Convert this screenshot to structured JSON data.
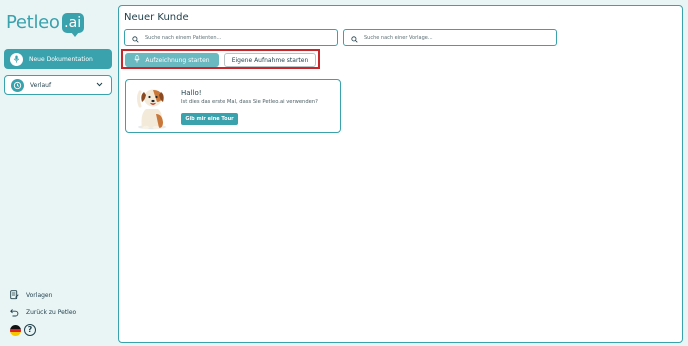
{
  "brand": {
    "logo_word": "Petleo",
    "logo_suffix": ".ai"
  },
  "sidebar": {
    "new_doc_label": "Neue Dokumentation",
    "history_label": "Verlauf",
    "footer": {
      "templates_label": "Vorlagen",
      "back_label": "Zurück zu Petleo",
      "help_glyph": "?"
    }
  },
  "main": {
    "title": "Neuer Kunde",
    "search_patient_placeholder": "Suche nach einem Patienten...",
    "search_template_placeholder": "Suche nach einer Vorlage...",
    "start_recording_label": "Aufzeichnung starten",
    "own_recording_label": "Eigene Aufnahme starten",
    "welcome": {
      "title": "Hallo!",
      "text": "Ist dies das erste Mal, dass Sie Petleo.ai verwenden?",
      "tour_label": "Gib mir eine Tour"
    }
  },
  "colors": {
    "accent": "#3aa2ad",
    "accent_light": "#6ab8c0",
    "background": "#e9f4f5",
    "highlight": "#c8262b"
  }
}
